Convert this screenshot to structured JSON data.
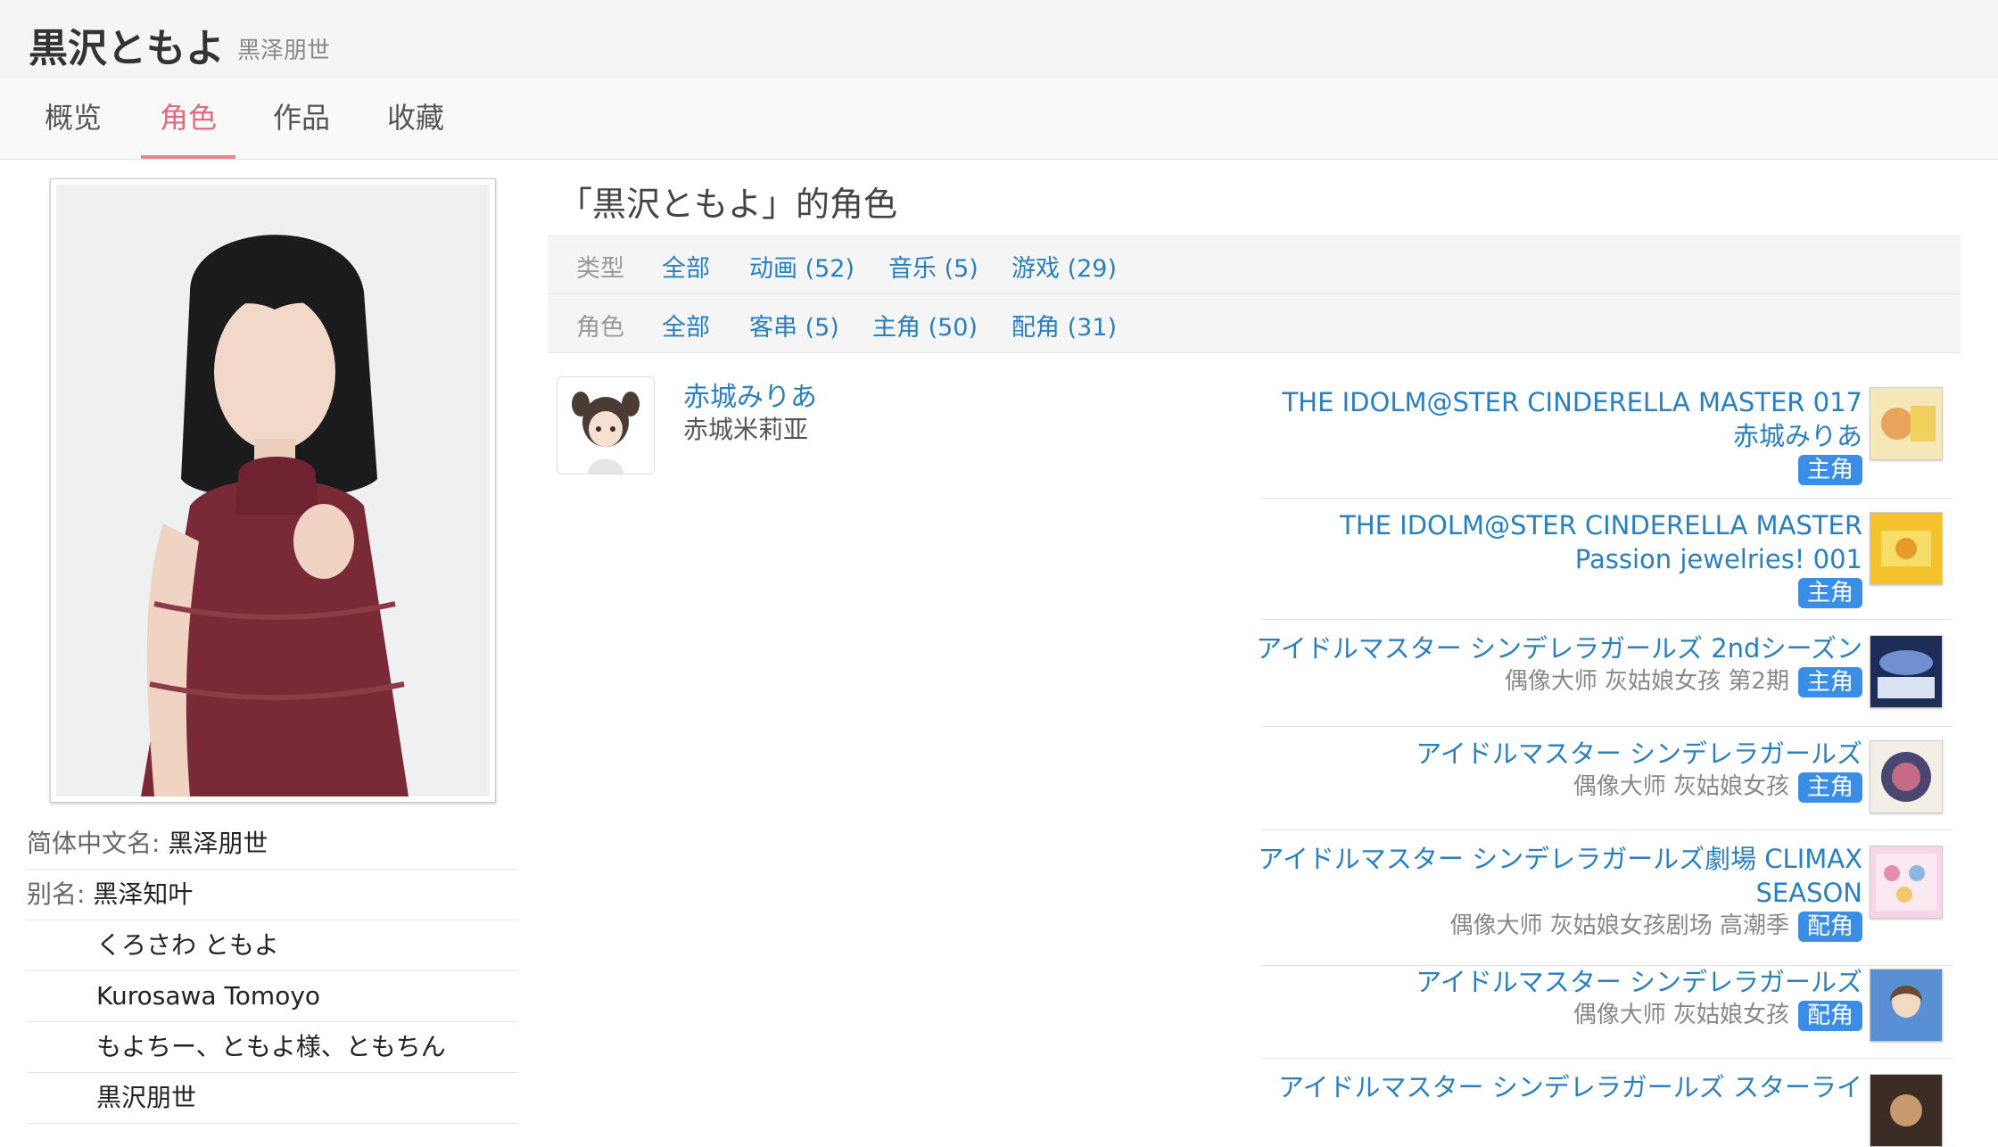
{
  "header": {
    "title": "黒沢ともよ",
    "subtitle": "黑泽朋世"
  },
  "tabs": [
    {
      "label": "概览"
    },
    {
      "label": "角色",
      "active": true
    },
    {
      "label": "作品"
    },
    {
      "label": "收藏"
    }
  ],
  "sidebar": {
    "info": [
      {
        "label": "简体中文名: ",
        "value": "黑泽朋世"
      },
      {
        "label": "别名: ",
        "value": "黑泽知叶"
      },
      {
        "label": "",
        "value": "くろさわ ともよ"
      },
      {
        "label": "",
        "value": "Kurosawa Tomoyo"
      },
      {
        "label": "",
        "value": "もよちー、ともよ様、ともちん"
      },
      {
        "label": "",
        "value": "黒沢朋世"
      }
    ]
  },
  "main": {
    "section_title": "「黒沢ともよ」的角色",
    "filters": {
      "type_label": "类型",
      "type_options": [
        "全部",
        "动画 (52)",
        "音乐 (5)",
        "游戏 (29)"
      ],
      "role_label": "角色",
      "role_options": [
        "全部",
        "客串 (5)",
        "主角 (50)",
        "配角 (31)"
      ]
    },
    "character": {
      "name": "赤城みりあ",
      "name_cn": "赤城米莉亚"
    },
    "works": [
      {
        "title": "THE IDOLM@STER CINDERELLA MASTER 017 赤城みりあ",
        "subtitle": "",
        "role": "主角"
      },
      {
        "title": "THE IDOLM@STER CINDERELLA MASTER Passion jewelries! 001",
        "subtitle": "",
        "role": "主角"
      },
      {
        "title": "アイドルマスター シンデレラガールズ 2ndシーズン",
        "subtitle": "偶像大师 灰姑娘女孩 第2期",
        "role": "主角"
      },
      {
        "title": "アイドルマスター シンデレラガールズ",
        "subtitle": "偶像大师 灰姑娘女孩",
        "role": "主角"
      },
      {
        "title": "アイドルマスター シンデレラガールズ劇場 CLIMAX SEASON",
        "subtitle": "偶像大师 灰姑娘女孩剧场 高潮季",
        "role": "配角"
      },
      {
        "title": "アイドルマスター シンデレラガールズ",
        "subtitle": "偶像大师 灰姑娘女孩",
        "role": "配角"
      },
      {
        "title": "アイドルマスター シンデレラガールズ スターライ",
        "subtitle": "",
        "role": ""
      }
    ]
  },
  "colors": {
    "link": "#2a7fbf",
    "active_tab": "#e1697b",
    "badge": "#3a8ee6"
  }
}
